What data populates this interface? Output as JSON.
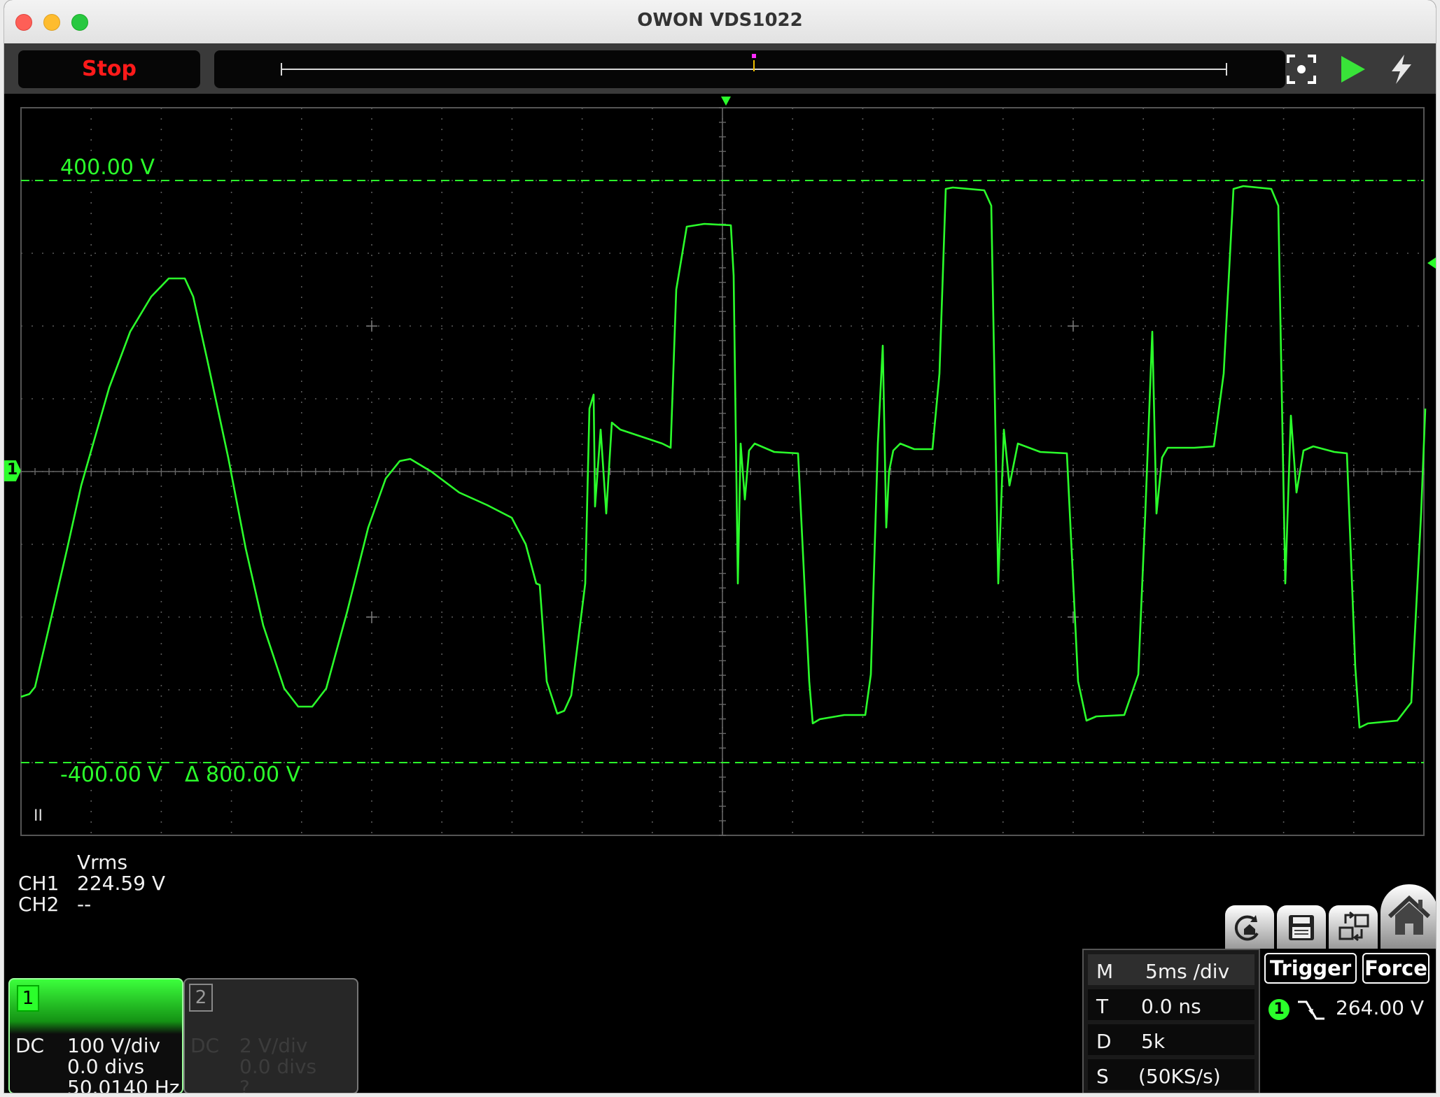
{
  "window": {
    "title": "OWON VDS1022"
  },
  "toolbar": {
    "stop_label": "Stop"
  },
  "cursors": {
    "upper": "400.00 V",
    "lower": "-400.00 V",
    "delta": "Δ 800.00 V"
  },
  "channel_marker": "1",
  "pause_indicator": "II",
  "measurements": {
    "header": "Vrms",
    "rows": [
      {
        "channel": "CH1",
        "value": "224.59 V"
      },
      {
        "channel": "CH2",
        "value": "--"
      }
    ]
  },
  "channels": [
    {
      "number": "1",
      "coupling": "DC",
      "scale": "100 V/div",
      "position": "0.0 divs",
      "frequency": "50.0140 Hz",
      "active": true
    },
    {
      "number": "2",
      "coupling": "DC",
      "scale": "2 V/div",
      "position": "0.0 divs",
      "frequency": "?",
      "active": false
    }
  ],
  "timebase": [
    {
      "key": "M",
      "value": "5ms /div"
    },
    {
      "key": "T",
      "value": "0.0 ns"
    },
    {
      "key": "D",
      "value": "5k"
    },
    {
      "key": "S",
      "value": "(50KS/s)"
    }
  ],
  "trigger": {
    "trigger_label": "Trigger",
    "force_label": "Force",
    "source": "1",
    "level": "264.00 V"
  },
  "colors": {
    "trace": "#2bff2b",
    "stop": "#ff1a1a",
    "grid": "#6a6a6a",
    "background": "#000000"
  }
}
